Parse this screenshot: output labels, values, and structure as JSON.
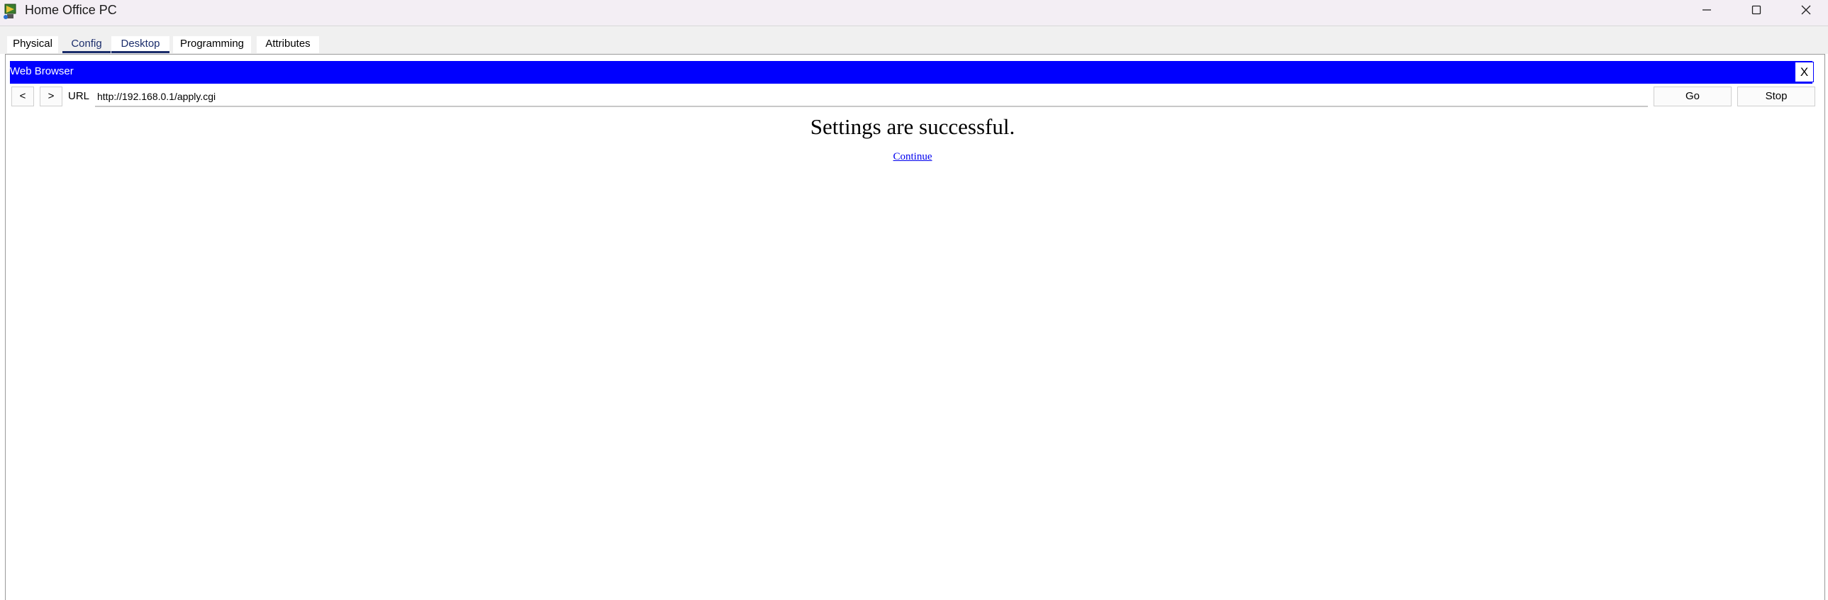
{
  "window": {
    "title": "Home Office PC",
    "icons": {
      "app": "packet-tracer-pc-icon",
      "minimize": "minimize-icon",
      "maximize": "maximize-icon",
      "close": "close-icon"
    }
  },
  "tabs": [
    {
      "label": "Physical"
    },
    {
      "label": "Config"
    },
    {
      "label": "Desktop"
    },
    {
      "label": "Programming"
    },
    {
      "label": "Attributes"
    }
  ],
  "active_tab": "Desktop",
  "browser": {
    "title": "Web Browser",
    "close_label": "X",
    "back_label": "<",
    "forward_label": ">",
    "url_label": "URL",
    "url_value": "http://192.168.0.1/apply.cgi",
    "go_label": "Go",
    "stop_label": "Stop",
    "header_color": "#0000ff"
  },
  "page": {
    "message": "Settings are successful.",
    "link_text": "Continue"
  }
}
